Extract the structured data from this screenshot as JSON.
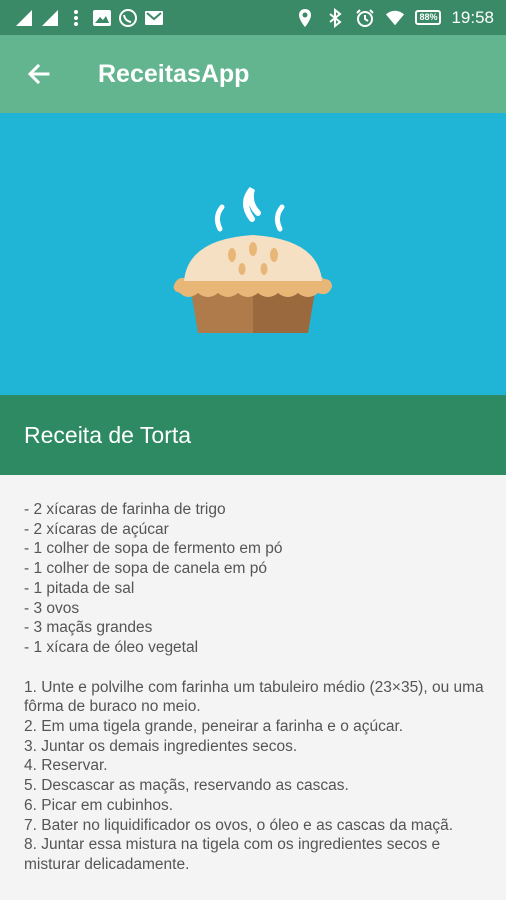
{
  "status_bar": {
    "time": "19:58",
    "battery": "88%"
  },
  "app_bar": {
    "title": "ReceitasApp"
  },
  "recipe": {
    "title": "Receita de Torta",
    "ingredients": [
      "- 2 xícaras de farinha de trigo",
      "- 2 xícaras de açúcar",
      "- 1 colher de sopa de fermento em pó",
      "- 1 colher de sopa de canela em pó",
      "- 1 pitada de sal",
      "- 3 ovos",
      "- 3 maçãs grandes",
      "- 1 xícara de óleo vegetal"
    ],
    "steps": [
      "1. Unte e polvilhe com farinha um tabuleiro médio (23×35), ou uma fôrma de buraco no meio.",
      "2. Em uma tigela grande, peneirar a farinha e o açúcar.",
      "3. Juntar os demais ingredientes secos.",
      "4. Reservar.",
      "5. Descascar as maçãs, reservando as cascas.",
      "6. Picar em cubinhos.",
      "7. Bater no liquidificador os ovos, o óleo e as cascas da maçã.",
      "8. Juntar essa mistura na tigela com os ingredientes secos e misturar delicadamente."
    ]
  },
  "colors": {
    "status_bar": "#3b8a67",
    "app_bar": "#63b58f",
    "hero": "#20b4d6",
    "title_bar": "#2d8a63"
  }
}
